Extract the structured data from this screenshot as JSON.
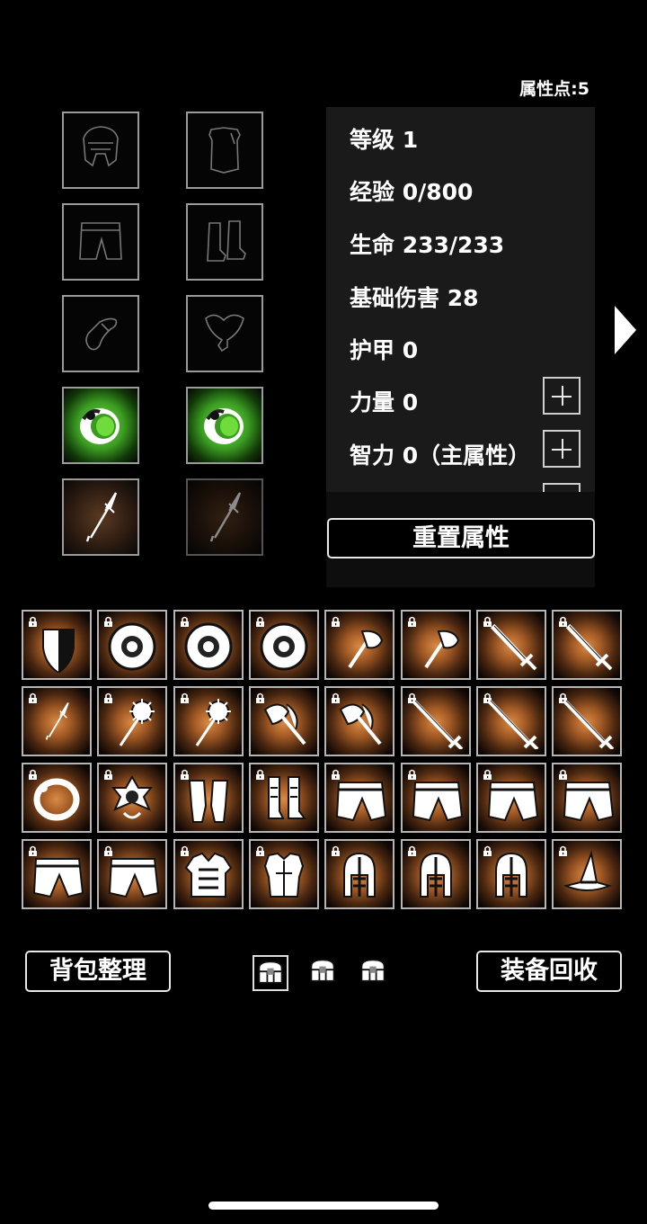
{
  "header": {
    "attr_points": "属性点:5"
  },
  "equip_slots": [
    {
      "icon": "helmet-outline-icon",
      "state": "empty"
    },
    {
      "icon": "armor-outline-icon",
      "state": "empty"
    },
    {
      "icon": "pants-outline-icon",
      "state": "empty"
    },
    {
      "icon": "boots-outline-icon",
      "state": "empty"
    },
    {
      "icon": "bracer-outline-icon",
      "state": "empty"
    },
    {
      "icon": "necklace-outline-icon",
      "state": "empty"
    },
    {
      "icon": "green-ring-icon",
      "state": "equipped"
    },
    {
      "icon": "green-ring-icon",
      "state": "equipped"
    },
    {
      "icon": "spear-icon",
      "state": "equipped"
    },
    {
      "icon": "spear-icon",
      "state": "dim"
    }
  ],
  "stats": {
    "level": "等级  1",
    "exp": "经验  0/800",
    "hp": "生命  233/233",
    "base_damage": "基础伤害  28",
    "armor": "护甲  0",
    "strength": "力量  0",
    "intellect": "智力  0（主属性）"
  },
  "buttons": {
    "reset": "重置属性",
    "sort": "背包整理",
    "recycle": "装备回收"
  },
  "inventory": [
    "shield-icon",
    "round-shield-icon",
    "round-shield-icon",
    "round-shield-icon",
    "axe-icon",
    "axe-icon",
    "sword-icon",
    "sword-icon",
    "spear-icon",
    "mace-icon",
    "mace-icon",
    "double-axe-icon",
    "double-axe-icon",
    "greatsword-icon",
    "greatsword-icon",
    "greatsword-icon",
    "ring-icon",
    "amulet-icon",
    "gloves-icon",
    "boots-icon",
    "pants-icon",
    "pants-icon",
    "pants-icon",
    "pants-icon",
    "pants-icon",
    "pants-icon",
    "chest-armor-icon",
    "breastplate-icon",
    "helmet-icon",
    "helmet-icon",
    "helmet-icon",
    "wizard-hat-icon"
  ],
  "bag_tabs": [
    {
      "selected": true
    },
    {
      "selected": false
    },
    {
      "selected": false
    }
  ],
  "colors": {
    "equipped_glow": "#5cc832",
    "inventory_glow": "#d98a45",
    "panel": "#1a1a1a"
  }
}
